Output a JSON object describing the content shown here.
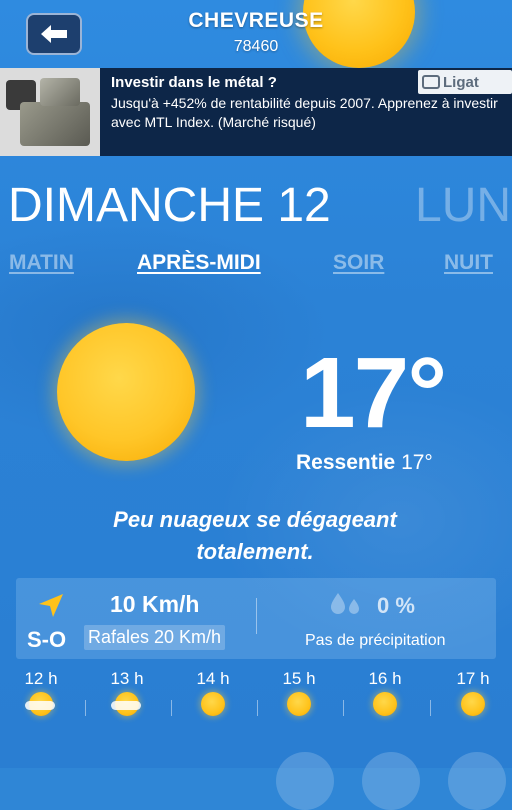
{
  "header": {
    "city": "CHEVREUSE",
    "zip": "78460",
    "back_icon": "arrow-left-icon"
  },
  "ad": {
    "title": "Investir dans le métal ?",
    "text": "Jusqu'à +452% de rentabilité depuis 2007. Apprenez à investir avec MTL Index. (Marché risqué)",
    "brand": "Ligat"
  },
  "days": {
    "active": "DIMANCHE 12",
    "next": "LUN"
  },
  "periods": [
    {
      "label": "MATIN",
      "active": false
    },
    {
      "label": "APRÈS-MIDI",
      "active": true
    },
    {
      "label": "SOIR",
      "active": false
    },
    {
      "label": "NUIT",
      "active": false
    }
  ],
  "current": {
    "temp": "17°",
    "feels_label": "Ressentie",
    "feels_value": "17°",
    "description": "Peu nuageux se dégageant totalement.",
    "icon": "sun-icon"
  },
  "wind": {
    "speed": "10 Km/h",
    "direction": "S-O",
    "gusts": "Rafales 20 Km/h",
    "icon": "wind-direction-arrow-icon"
  },
  "precipitation": {
    "value": "0 %",
    "label": "Pas de précipitation",
    "icon": "raindrops-icon"
  },
  "hourly": [
    {
      "hour": "12 h",
      "icon": "sun-cloud-icon"
    },
    {
      "hour": "13 h",
      "icon": "sun-cloud-icon"
    },
    {
      "hour": "14 h",
      "icon": "sun-icon"
    },
    {
      "hour": "15 h",
      "icon": "sun-icon"
    },
    {
      "hour": "16 h",
      "icon": "sun-icon"
    },
    {
      "hour": "17 h",
      "icon": "sun-icon"
    }
  ],
  "colors": {
    "background": "#2f86d6",
    "sun": "#ffc21a",
    "ad_background": "#0d2648"
  }
}
